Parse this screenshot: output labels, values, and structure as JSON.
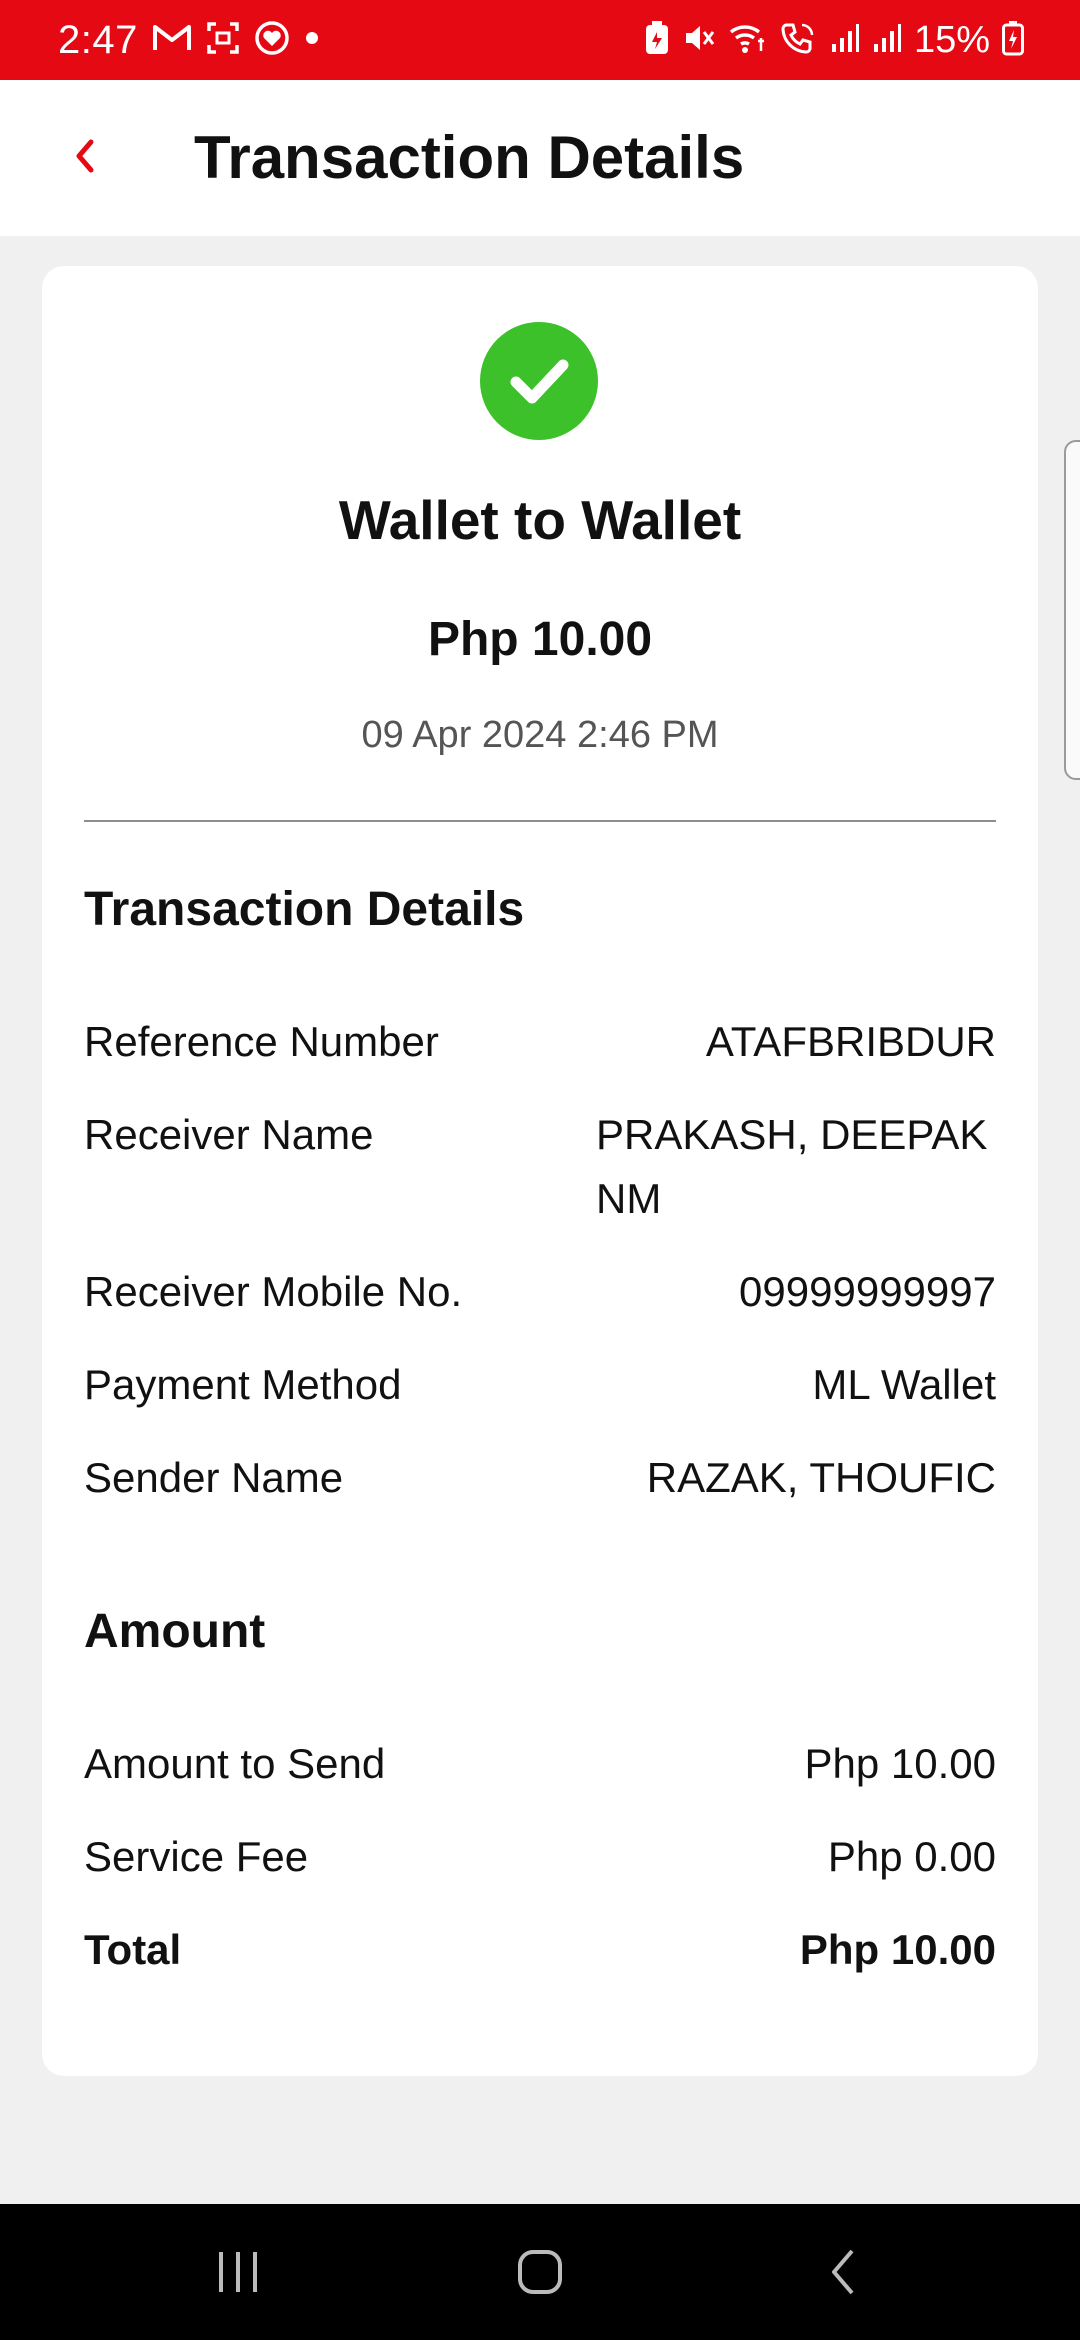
{
  "status_bar": {
    "time": "2:47",
    "battery_percent": "15%",
    "left_icons": [
      "gmail-icon",
      "screenshot-icon",
      "heart-app-icon",
      "dot-icon"
    ],
    "right_icons": [
      "battery-saver-icon",
      "mute-icon",
      "wifi-calling-icon",
      "volte-call-icon",
      "signal-icon",
      "signal-icon",
      "battery-charging-icon"
    ],
    "background_color": "#e50914"
  },
  "app_bar": {
    "title": "Transaction Details",
    "back_icon": "chevron-left-icon",
    "accent_color": "#e50914"
  },
  "summary": {
    "status_icon": "check-circle-icon",
    "status_color": "#3cc12a",
    "heading": "Wallet to Wallet",
    "amount": "Php 10.00",
    "datetime": "09 Apr 2024 2:46 PM"
  },
  "transaction_details": {
    "title": "Transaction Details",
    "rows": [
      {
        "label": "Reference Number",
        "value": "ATAFBRIBDUR"
      },
      {
        "label": "Receiver Name",
        "value": "PRAKASH, DEEPAK NM"
      },
      {
        "label": "Receiver Mobile No.",
        "value": "09999999997"
      },
      {
        "label": "Payment Method",
        "value": "ML Wallet"
      },
      {
        "label": "Sender Name",
        "value": "RAZAK, THOUFIC"
      }
    ]
  },
  "amount_section": {
    "title": "Amount",
    "rows": [
      {
        "label": "Amount to Send",
        "value": "Php 10.00"
      },
      {
        "label": "Service Fee",
        "value": "Php 0.00"
      }
    ],
    "total": {
      "label": "Total",
      "value": "Php 10.00"
    }
  },
  "nav_bar": {
    "buttons": [
      "recents-icon",
      "home-icon",
      "back-icon"
    ]
  }
}
